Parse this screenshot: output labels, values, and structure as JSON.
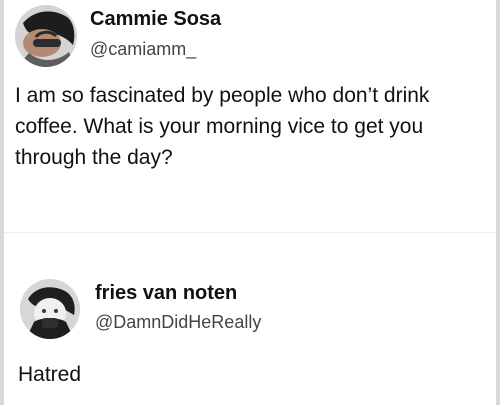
{
  "posts": [
    {
      "author": {
        "display_name": "Cammie Sosa",
        "handle": "@camiamm_"
      },
      "text": "I am so fascinated by people who don’t drink coffee. What is your morning vice to get you through the day?"
    },
    {
      "author": {
        "display_name": "fries van noten",
        "handle": "@DamnDidHeReally"
      },
      "text": "Hatred"
    }
  ],
  "colors": {
    "background": "#ffffff",
    "text": "#111111",
    "secondary_text": "#444444",
    "frame": "#d9d9d9"
  },
  "icons": {
    "avatar_1": "profile-photo-avatar",
    "avatar_2": "profile-photo-avatar"
  }
}
